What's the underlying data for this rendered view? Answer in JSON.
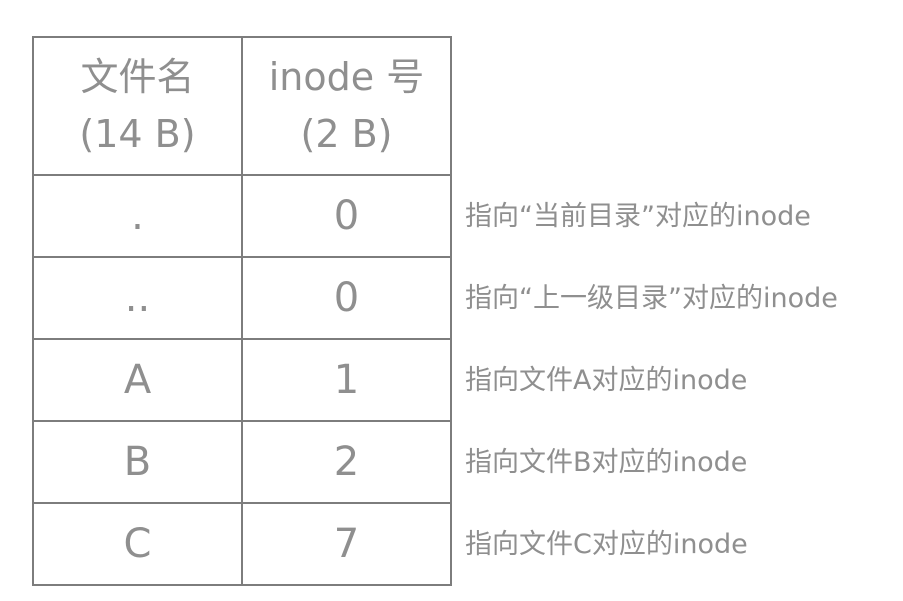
{
  "table": {
    "headers": {
      "name": {
        "line1": "文件名",
        "line2": "(14 B)"
      },
      "inode": {
        "line1": "inode 号",
        "line2": "(2 B)"
      }
    },
    "rows": [
      {
        "name": ".",
        "inode": "0",
        "note": "指向“当前目录”对应的inode"
      },
      {
        "name": "..",
        "inode": "0",
        "note": "指向“上一级目录”对应的inode"
      },
      {
        "name": "A",
        "inode": "1",
        "note": "指向文件A对应的inode"
      },
      {
        "name": "B",
        "inode": "2",
        "note": "指向文件B对应的inode"
      },
      {
        "name": "C",
        "inode": "7",
        "note": "指向文件C对应的inode"
      }
    ]
  }
}
